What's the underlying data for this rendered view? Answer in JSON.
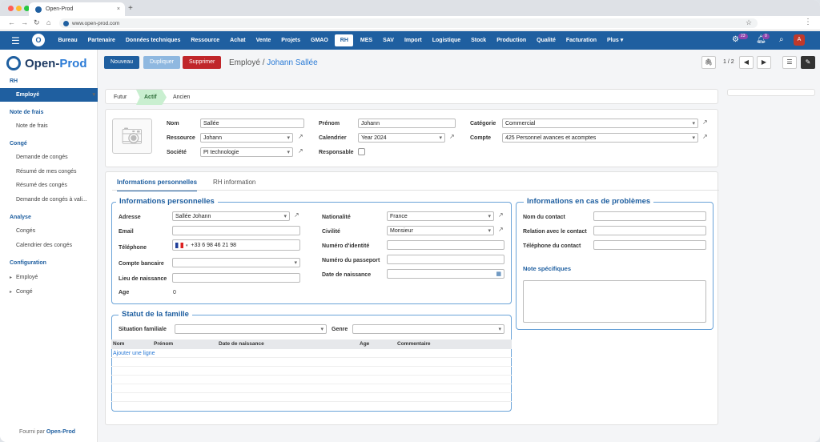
{
  "browser": {
    "tab_title": "Open-Prod",
    "url": "www.open-prod.com"
  },
  "topnav": {
    "items": [
      "Bureau",
      "Partenaire",
      "Données techniques",
      "Ressource",
      "Achat",
      "Vente",
      "Projets",
      "GMAO",
      "RH",
      "MES",
      "SAV",
      "Import",
      "Logistique",
      "Stock",
      "Production",
      "Qualité",
      "Facturation",
      "Plus ▾"
    ],
    "active": "RH",
    "badge_activity": "23",
    "badge_notifications": "0",
    "avatar_letter": "A"
  },
  "sidebar": {
    "brand_a": "Open-",
    "brand_b": "Prod",
    "sections": [
      {
        "title": "RH",
        "items": [
          "Employé"
        ]
      },
      {
        "title": "Note de frais",
        "items": [
          "Note de frais"
        ]
      },
      {
        "title": "Congé",
        "items": [
          "Demande de congés",
          "Résumé de mes congés",
          "Résumé des congés",
          "Demande de congés à vali..."
        ]
      },
      {
        "title": "Analyse",
        "items": [
          "Congés",
          "Calendrier des congés"
        ]
      },
      {
        "title": "Configuration",
        "items": [
          "Employé",
          "Congé"
        ]
      }
    ],
    "footer_prefix": "Fourni par",
    "footer_brand": "Open-Prod"
  },
  "actions": {
    "new": "Nouveau",
    "duplicate": "Dupliquer",
    "delete": "Supprimer",
    "crumb_parent": "Employé",
    "crumb_sep": "/",
    "crumb_current": "Johann Sallée",
    "pager": "1 / 2"
  },
  "status": {
    "steps": [
      "Futur",
      "Actif",
      "Ancien"
    ],
    "current": "Actif"
  },
  "form": {
    "labels": {
      "nom": "Nom",
      "ressource": "Ressource",
      "societe": "Société",
      "prenom": "Prénom",
      "calendrier": "Calendrier",
      "responsable": "Responsable",
      "categorie": "Catégorie",
      "compte": "Compte"
    },
    "values": {
      "nom": "Sallée",
      "ressource": "Johann",
      "societe": "PI technologie",
      "prenom": "Johann",
      "calendrier": "Year 2024",
      "categorie": "Commercial",
      "compte": "425 Personnel avances et acomptes"
    }
  },
  "tabs": {
    "personal": "Informations personnelles",
    "hr": "RH information"
  },
  "personal": {
    "title": "Informations personnelles",
    "labels": {
      "adresse": "Adresse",
      "email": "Email",
      "telephone": "Téléphone",
      "compte_bancaire": "Compte bancaire",
      "lieu_naissance": "Lieu de naissance",
      "age": "Age",
      "nationalite": "Nationalité",
      "civilite": "Civilité",
      "numero_identite": "Numéro d'identité",
      "numero_passeport": "Numéro du passeport",
      "date_naissance": "Date de naissance"
    },
    "values": {
      "adresse": "Sallée Johann",
      "telephone": "+33 6 98 46 21 98",
      "age": "0",
      "nationalite": "France",
      "civilite": "Monsieur"
    }
  },
  "emergency": {
    "title": "Informations en cas de problèmes",
    "labels": {
      "nom_contact": "Nom du contact",
      "relation": "Relation avec le contact",
      "tel_contact": "Téléphone du contact",
      "note": "Note spécifiques"
    }
  },
  "family": {
    "title": "Statut de la famille",
    "labels": {
      "situation": "Situation familiale",
      "genre": "Genre"
    },
    "columns": [
      "Nom",
      "Prénom",
      "Date de naissance",
      "Age",
      "Commentaire"
    ],
    "add_line": "Ajouter une ligne"
  }
}
